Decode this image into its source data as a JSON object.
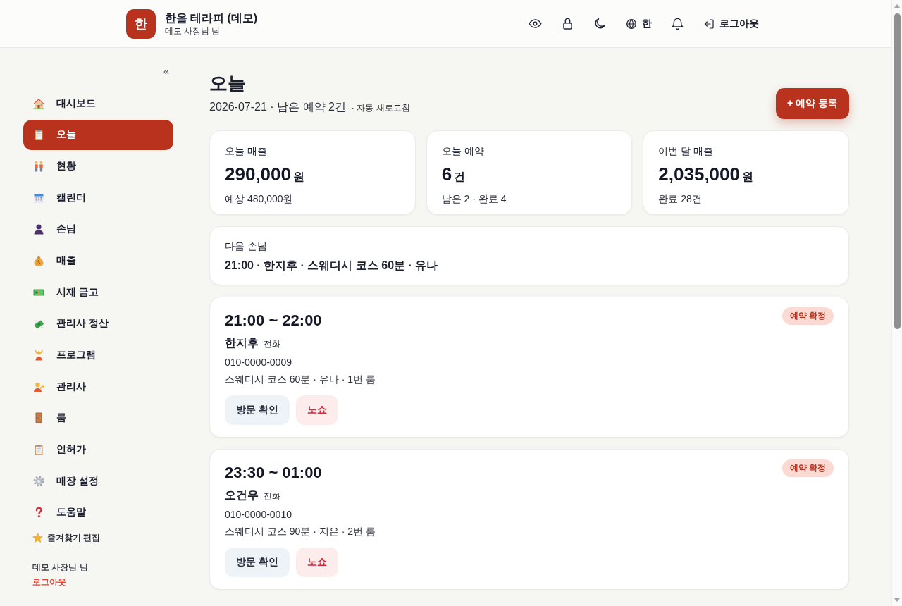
{
  "header": {
    "logo": "한",
    "title": "한올 테라피 (데모)",
    "subtitle": "데모 사장님 님",
    "language_button": "한",
    "logout_button": "로그아웃"
  },
  "sidebar": {
    "collapse": "«",
    "items": [
      {
        "label": "대시보드",
        "selected": false
      },
      {
        "label": "오늘",
        "selected": true
      },
      {
        "label": "현황",
        "selected": false
      },
      {
        "label": "캘린더",
        "selected": false
      },
      {
        "label": "손님",
        "selected": false
      },
      {
        "label": "매출",
        "selected": false
      },
      {
        "label": "시재 금고",
        "selected": false
      },
      {
        "label": "관리사 정산",
        "selected": false
      },
      {
        "label": "프로그램",
        "selected": false
      },
      {
        "label": "관리사",
        "selected": false
      },
      {
        "label": "룸",
        "selected": false
      },
      {
        "label": "인허가",
        "selected": false
      },
      {
        "label": "매장 설정",
        "selected": false
      },
      {
        "label": "도움말",
        "selected": false
      }
    ],
    "favorites_edit": "즐겨찾기 편집",
    "user_name": "데모 사장님 님",
    "logout": "로그아웃"
  },
  "page": {
    "title": "오늘",
    "subtitle": "2026-07-21 · 남은 예약 2건",
    "auto_refresh": "· 자동 새로고침",
    "add_button": "+ 예약 등록"
  },
  "stats": [
    {
      "label": "오늘 매출",
      "value": "290,000",
      "unit": "원",
      "note": "예상 480,000원"
    },
    {
      "label": "오늘 예약",
      "value": "6",
      "unit": "건",
      "note": "남은 2 · 완료 4"
    },
    {
      "label": "이번 달 매출",
      "value": "2,035,000",
      "unit": "원",
      "note": "완료 28건"
    }
  ],
  "next_guest": {
    "label": "다음 손님",
    "text": "21:00 · 한지후 · 스웨디시 코스 60분 · 유나"
  },
  "bookings": [
    {
      "time": "21:00 ~ 22:00",
      "status": "예약 확정",
      "name": "한지후",
      "channel": "전화",
      "phone": "010-0000-0009",
      "details": "스웨디시 코스 60분 · 유나 · 1번 룸",
      "actions": [
        {
          "label": "방문 확인",
          "kind": "confirm"
        },
        {
          "label": "노쇼",
          "kind": "noshow"
        }
      ]
    },
    {
      "time": "23:30 ~ 01:00",
      "status": "예약 확정",
      "name": "오건우",
      "channel": "전화",
      "phone": "010-0000-0010",
      "details": "스웨디시 코스 90분 · 지은 · 2번 룸",
      "actions": [
        {
          "label": "방문 확인",
          "kind": "confirm"
        },
        {
          "label": "노쇼",
          "kind": "noshow"
        }
      ]
    }
  ]
}
